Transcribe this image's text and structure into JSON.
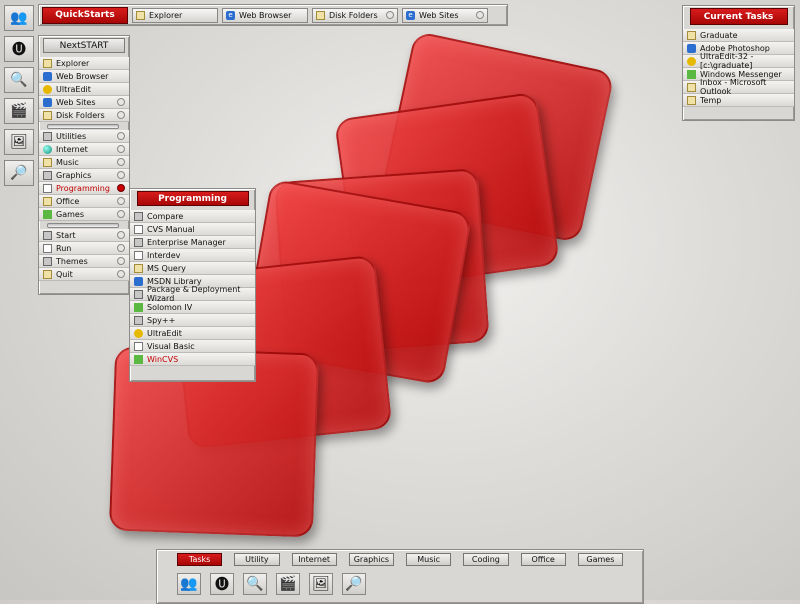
{
  "quickstarts": {
    "title": "QuickStarts",
    "items": [
      {
        "label": "Explorer",
        "icon": "explorer-icon"
      },
      {
        "label": "Web Browser",
        "icon": "web-browser-icon"
      },
      {
        "label": "Disk Folders",
        "icon": "disk-folders-icon"
      },
      {
        "label": "Web Sites",
        "icon": "web-sites-icon"
      }
    ]
  },
  "nextstart": {
    "title": "NextSTART",
    "items": [
      {
        "label": "Explorer"
      },
      {
        "label": "Web Browser"
      },
      {
        "label": "UltraEdit"
      },
      {
        "label": "Web Sites"
      },
      {
        "label": "Disk Folders"
      },
      {
        "label": "Utilities"
      },
      {
        "label": "Internet"
      },
      {
        "label": "Music"
      },
      {
        "label": "Graphics"
      },
      {
        "label": "Programming"
      },
      {
        "label": "Office"
      },
      {
        "label": "Games"
      },
      {
        "label": "Start"
      },
      {
        "label": "Run"
      },
      {
        "label": "Themes"
      },
      {
        "label": "Quit"
      }
    ]
  },
  "programming": {
    "title": "Programming",
    "items": [
      {
        "label": "Compare"
      },
      {
        "label": "CVS Manual"
      },
      {
        "label": "Enterprise Manager"
      },
      {
        "label": "Interdev"
      },
      {
        "label": "MS Query"
      },
      {
        "label": "MSDN Library"
      },
      {
        "label": "Package & Deployment Wizard"
      },
      {
        "label": "Solomon IV"
      },
      {
        "label": "Spy++"
      },
      {
        "label": "UltraEdit"
      },
      {
        "label": "Visual Basic"
      },
      {
        "label": "WinCVS"
      }
    ]
  },
  "tasks": {
    "title": "Current Tasks",
    "items": [
      {
        "label": "Graduate"
      },
      {
        "label": "Adobe Photoshop"
      },
      {
        "label": "UltraEdit-32 - [c:\\graduate]"
      },
      {
        "label": "Windows Messenger"
      },
      {
        "label": "Inbox - Microsoft Outlook"
      },
      {
        "label": "Temp"
      }
    ]
  },
  "bottom_tabs": [
    "Tasks",
    "Utility",
    "Internet",
    "Graphics",
    "Music",
    "Coding",
    "Office",
    "Games"
  ],
  "accent": "#c00000"
}
